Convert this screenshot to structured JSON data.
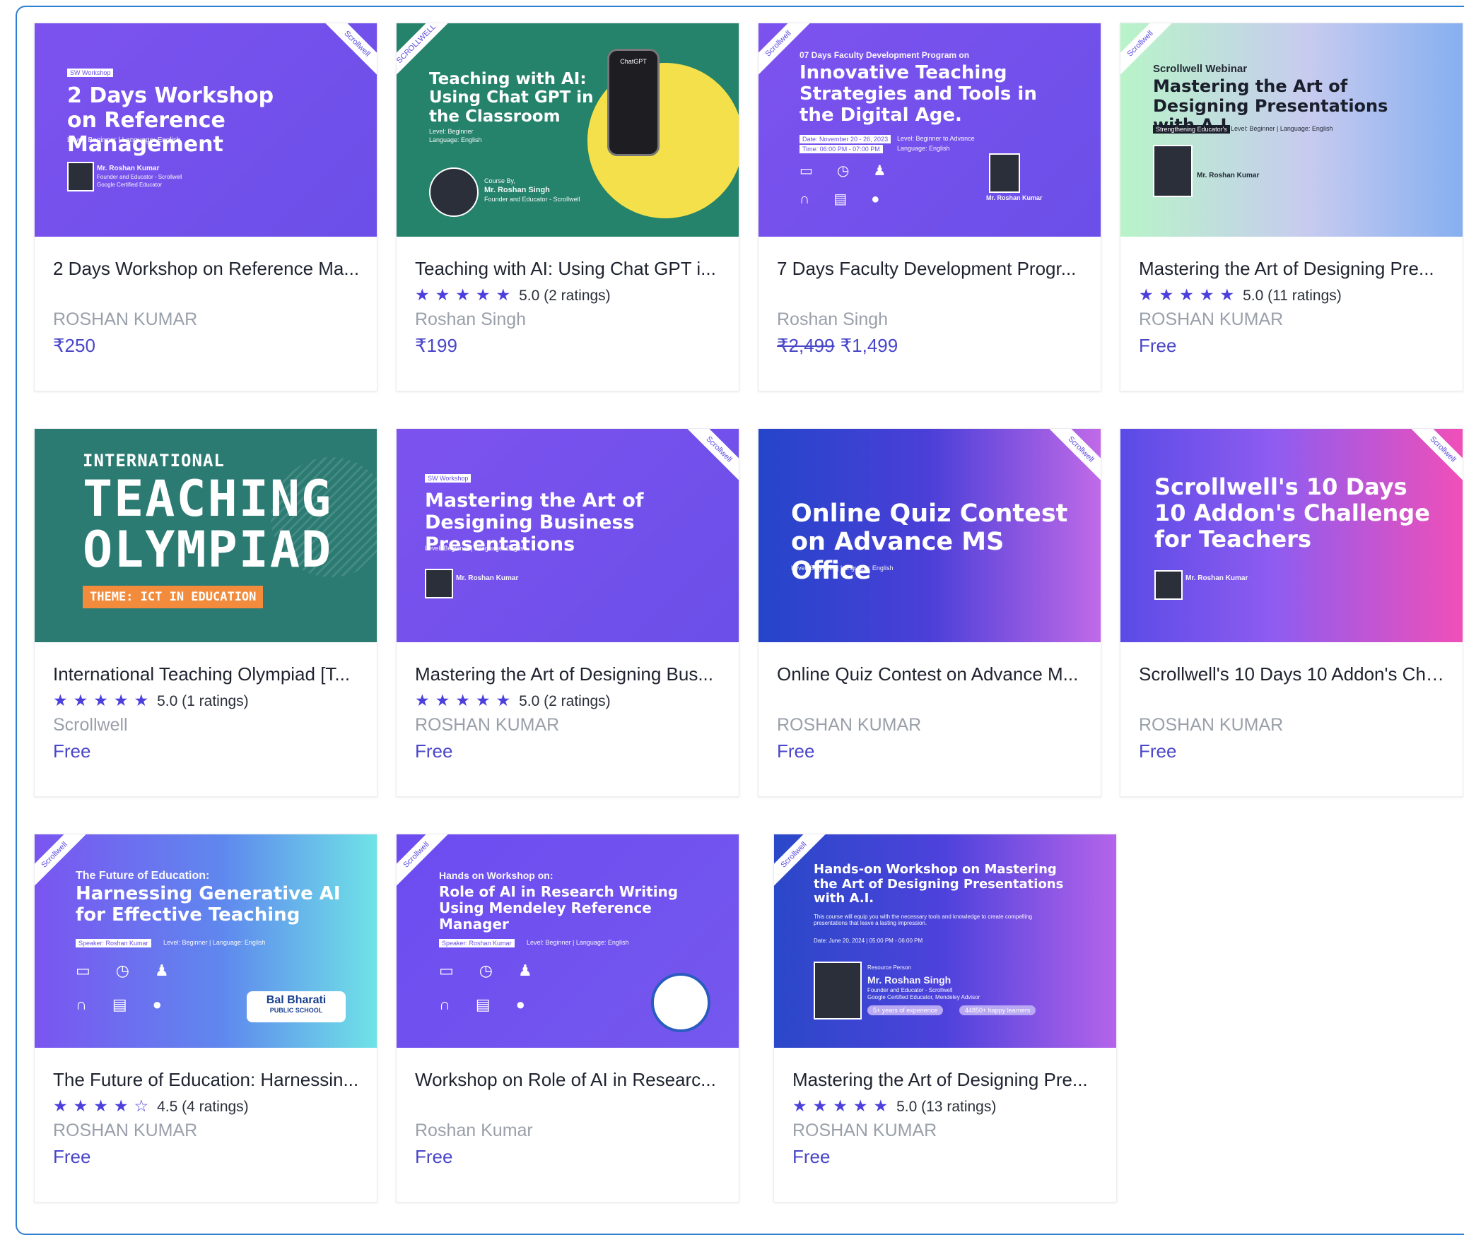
{
  "colors": {
    "frame": "#2f7fd0",
    "accent": "#4a46c9",
    "star": "#4c3fdb"
  },
  "courses": [
    {
      "title": "2 Days Workshop on Reference Ma...",
      "author": "ROSHAN KUMAR",
      "price": "₹250",
      "thumb": {
        "tag": "SW Workshop",
        "heading": "2 Days Workshop on Reference Management",
        "meta": "Level: Beginner | Language: English",
        "speaker": "Mr. Roshan Kumar",
        "speaker_role": "Founder and Educator - Scrollwell",
        "speaker_role2": "Google Certified Educator",
        "corner": "Scrollwell"
      }
    },
    {
      "title": "Teaching with AI: Using Chat GPT i...",
      "stars": "★★★★★",
      "rating": "5.0 (2 ratings)",
      "author": "Roshan Singh",
      "price": "₹199",
      "thumb": {
        "heading": "Teaching with AI: Using Chat GPT in the Classroom",
        "meta1": "Level: Beginner",
        "meta2": "Language: English",
        "course_by": "Course By,",
        "speaker": "Mr. Roshan Singh",
        "speaker_role": "Founder and Educator - Scrollwell",
        "phone": "ChatGPT",
        "corner": "SCROLLWELL"
      }
    },
    {
      "title": "7 Days Faculty Development Progr...",
      "author": "Roshan Singh",
      "price_old": "₹2,499",
      "price": "₹1,499",
      "thumb": {
        "subheading": "07 Days Faculty Development Program on",
        "heading": "Innovative Teaching Strategies and Tools in the Digital Age.",
        "date": "Date: November 20 - 26, 2023",
        "time": "Time: 06:00 PM - 07:00 PM",
        "level": "Level: Beginner to Advance",
        "language": "Language: English",
        "speaker": "Mr. Roshan Kumar",
        "corner": "Scrollwell"
      }
    },
    {
      "title": "Mastering the Art of Designing Pre...",
      "stars": "★★★★★",
      "rating": "5.0 (11 ratings)",
      "author": "ROSHAN KUMAR",
      "price": "Free",
      "thumb": {
        "subheading": "Scrollwell Webinar",
        "heading": "Mastering the Art of Designing Presentations with A.I",
        "tag": "Strengthening Educator's",
        "meta": "Level: Beginner | Language: English",
        "speaker": "Mr. Roshan Kumar",
        "corner": "Scrollwell"
      }
    },
    {
      "title": "International Teaching Olympiad [T...",
      "stars": "★★★★★",
      "rating": "5.0 (1 ratings)",
      "author": "Scrollwell",
      "price": "Free",
      "thumb": {
        "line1": "INTERNATIONAL",
        "line2": "TEACHING",
        "line3": "OLYMPIAD",
        "theme": "THEME: ICT IN EDUCATION"
      }
    },
    {
      "title": "Mastering the Art of Designing Bus...",
      "stars": "★★★★★",
      "rating": "5.0 (2 ratings)",
      "author": "ROSHAN KUMAR",
      "price": "Free",
      "thumb": {
        "tag": "SW Workshop",
        "heading": "Mastering the Art of Designing Business Presentations",
        "meta": "Level: Beginner | Language: English",
        "speaker": "Mr. Roshan Kumar",
        "corner": "Scrollwell"
      }
    },
    {
      "title": "Online Quiz Contest on Advance M...",
      "author": "ROSHAN KUMAR",
      "price": "Free",
      "thumb": {
        "heading": "Online Quiz Contest on Advance MS Office",
        "meta": "Level: Beginner | Language: English",
        "corner": "Scrollwell"
      }
    },
    {
      "title": "Scrollwell's 10 Days 10 Addon's Cha...",
      "author": "ROSHAN KUMAR",
      "price": "Free",
      "thumb": {
        "heading": "Scrollwell's 10 Days 10 Addon's Challenge for Teachers",
        "speaker": "Mr. Roshan Kumar",
        "corner": "Scrollwell"
      }
    },
    {
      "title": "The Future of Education: Harnessin...",
      "stars": "★★★★☆",
      "rating": "4.5 (4 ratings)",
      "author": "ROSHAN KUMAR",
      "price": "Free",
      "thumb": {
        "subheading": "The Future of Education:",
        "heading": "Harnessing Generative AI for Effective Teaching",
        "speaker_tag": "Speaker: Roshan Kumar",
        "meta": "Level: Beginner | Language: English",
        "logo": "Bal Bharati",
        "logo_sub": "PUBLIC SCHOOL",
        "corner": "Scrollwell"
      }
    },
    {
      "title": "Workshop on Role of AI in Researc...",
      "author": "Rosha​n Kumar",
      "price": "Free",
      "thumb": {
        "subheading": "Hands on Workshop on:",
        "heading": "Role of AI in Research Writing Using Mendeley Reference Manager",
        "speaker_tag": "Speaker: Roshan Kumar",
        "meta": "Level: Beginner | Language: English",
        "corner": "Scrollwell"
      }
    },
    {
      "title": "Mastering the Art of Designing Pre...",
      "stars": "★★★★★",
      "rating": "5.0 (13 ratings)",
      "author": "ROSHAN KUMAR",
      "price": "Free",
      "thumb": {
        "heading": "Hands-on Workshop on Mastering the Art of Designing Presentations with A.I.",
        "desc": "This course will equip you with the necessary tools and knowledge to create compelling presentations that leave a lasting impression.",
        "date": "Date: June 20, 2024 | 05:00 PM - 06:00 PM",
        "resource": "Resource Person",
        "speaker": "Mr. Roshan Singh",
        "speaker_role": "Founder and Educator - Scrollwell",
        "speaker_role2": "Google Certified Educator, Mendeley Advisor",
        "pill1": "5+ years of experience",
        "pill2": "44850+ happy learners",
        "corner": "Scrollwell"
      }
    }
  ]
}
